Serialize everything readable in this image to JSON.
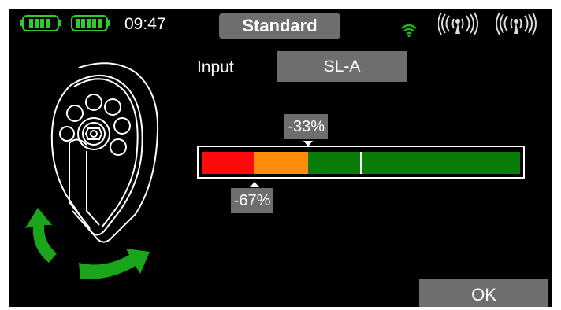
{
  "status_bar": {
    "time": "09:47",
    "mode_label": "Standard",
    "battery_icons": [
      "battery-icon",
      "battery-icon"
    ],
    "signal_icons": [
      "wifi-icon",
      "antenna-icon",
      "antenna-icon"
    ]
  },
  "input": {
    "label": "Input",
    "value": "SL-A"
  },
  "bar": {
    "min_percent": -100,
    "max_percent": 100,
    "lower_marker_percent": -67,
    "upper_marker_percent": -33,
    "center_percent": 0,
    "lower_label": "-67%",
    "upper_label": "-33%",
    "colors": {
      "low": "#ff0a0a",
      "mid": "#ff8c0a",
      "high": "#0a7c0a",
      "accent_green": "#1aa61a"
    }
  },
  "buttons": {
    "ok_label": "OK"
  },
  "illustration": {
    "icon": "rotary-dial-icon",
    "arrows_icon": "rotate-arrows-icon"
  }
}
